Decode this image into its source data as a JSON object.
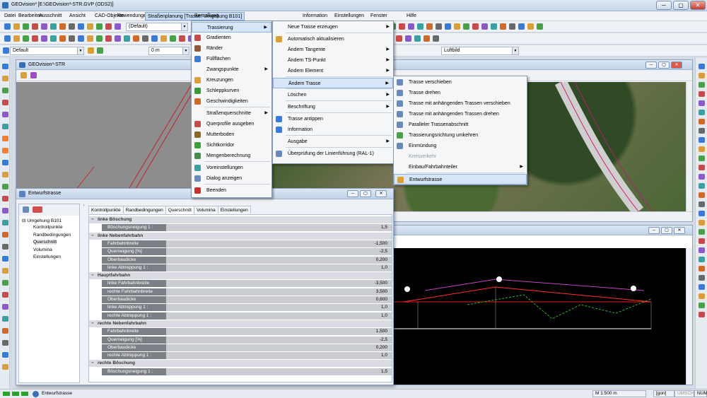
{
  "window": {
    "title": "GEOvision³  [E:\\GEOvision³-STR.GVP (ODS2)]",
    "min": "─",
    "max": "▢",
    "close": "✕"
  },
  "menubar": [
    "Datei",
    "Bearbeiten",
    "Ausschnitt",
    "Ansicht",
    "CAD-Objekte",
    "Anwendungen",
    "Straßenplanung [Trasse: Umgehung B101]",
    "Bemaßung",
    "Information",
    "Einstellungen",
    "Fenster",
    "Hilfe"
  ],
  "toolbar": {
    "style_combo": "(Default)",
    "layer_combo": "Default",
    "offset_combo": "0 m",
    "view_combo": "Luftbild"
  },
  "map_window": {
    "title": "GEOvision³-STR"
  },
  "menu1": [
    {
      "label": "Trassierung",
      "sub": "▶",
      "hl": true
    },
    {
      "label": "Gradienten"
    },
    {
      "label": "Ränder"
    },
    {
      "label": "Füllflächen"
    },
    {
      "label": "Zwangspunkte",
      "sub": "▶"
    },
    {
      "label": "Kreuzungen"
    },
    {
      "label": "Schleppkurven"
    },
    {
      "label": "Geschwindigkeiten"
    },
    {
      "label": "Straßenquerschnitte",
      "sub": "▶"
    },
    {
      "label": "Querprofile ausgeben"
    },
    {
      "label": "Mutterboden"
    },
    {
      "label": "Sichtkorridor"
    },
    {
      "label": "Mengenberechnung"
    },
    {
      "label": "Voreinstellungen"
    },
    {
      "label": "Dialog anzeigen"
    },
    {
      "label": "Beenden"
    }
  ],
  "menu2": [
    {
      "label": "Neue Trasse erzeugen",
      "sub": "▶"
    },
    {
      "label": "Automatisch aktualisieren"
    },
    {
      "label": "Ändern Tangente",
      "sub": "▶"
    },
    {
      "label": "Ändern TS-Punkt",
      "sub": "▶"
    },
    {
      "label": "Ändern Element",
      "sub": "▶"
    },
    {
      "label": "Ändern Trasse",
      "sub": "▶",
      "hl": true
    },
    {
      "label": "Löschen",
      "sub": "▶"
    },
    {
      "label": "Beschriftung",
      "sub": "▶"
    },
    {
      "label": "Trasse antippen"
    },
    {
      "label": "Information"
    },
    {
      "label": "Ausgabe",
      "sub": "▶"
    },
    {
      "label": "Überprüfung der Linienführung (RAL-1)"
    }
  ],
  "menu3": [
    {
      "label": "Trasse verschieben"
    },
    {
      "label": "Trasse drehen"
    },
    {
      "label": "Trasse mit anhängenden Trassen verschieben"
    },
    {
      "label": "Trasse mit anhängenden Trassen drehen"
    },
    {
      "label": "Paralleler Trassenabschnitt"
    },
    {
      "label": "Trassierungsrichtung umkehren"
    },
    {
      "label": "Einmündung"
    },
    {
      "label": "Kreisverkehr",
      "dim": true
    },
    {
      "label": "Einbau/Fahrbahnteiler",
      "sub": "▶"
    },
    {
      "label": "Entwurfstrasse",
      "hl": true
    }
  ],
  "panel": {
    "title": "Entwurfstrasse",
    "tabs": [
      "Kontrollpunkte",
      "Randbedingungen",
      "Querschnitt",
      "Volumina",
      "Einstellungen"
    ],
    "active_tab": "Querschnitt",
    "tree": {
      "root": "Umgehung B101",
      "children": [
        "Kontrollpunkte",
        "Randbedingungen",
        "Querschnitt",
        "Volumina",
        "Einstellungen"
      ]
    },
    "rows": [
      {
        "sec": "linke Böschung"
      },
      {
        "k": "Böschungsneigung 1 :",
        "v": "1,5"
      },
      {
        "sec": "linke Nebenfahrbahn"
      },
      {
        "k": "Fahrbahnbreite",
        "v": "-1,500"
      },
      {
        "k": "Querneigung [%]",
        "v": "-2,5"
      },
      {
        "k": "Oberbaudicke",
        "v": "0,200"
      },
      {
        "k": "linke Abtreppung 1 :",
        "v": "1,0"
      },
      {
        "sec": "Hauptfahrbahn"
      },
      {
        "k": "linke Fahrbahnbreite",
        "v": "-3,500"
      },
      {
        "k": "rechte Fahrbahnbreite",
        "v": "3,500"
      },
      {
        "k": "Oberbaudicke",
        "v": "0,600"
      },
      {
        "k": "linke Abtreppung 1 :",
        "v": "1,0"
      },
      {
        "k": "rechte Abtreppung 1 :",
        "v": "1,0"
      },
      {
        "sec": "rechte Nebenfahrbahn"
      },
      {
        "k": "Fahrbahnbreite",
        "v": "1,500"
      },
      {
        "k": "Querneigung [%]",
        "v": "-2,5"
      },
      {
        "k": "Oberbaudicke",
        "v": "0,200"
      },
      {
        "k": "rechte Abtreppung 1 :",
        "v": "1,0"
      },
      {
        "sec": "rechte Böschung"
      },
      {
        "k": "Böschungsneigung 1 :",
        "v": "1,5"
      }
    ]
  },
  "status": {
    "text": "Entwurfstrasse",
    "scale": "M 1:500  m",
    "unit": "[gon]",
    "umsch": "UMSCH",
    "num": "NUM"
  }
}
